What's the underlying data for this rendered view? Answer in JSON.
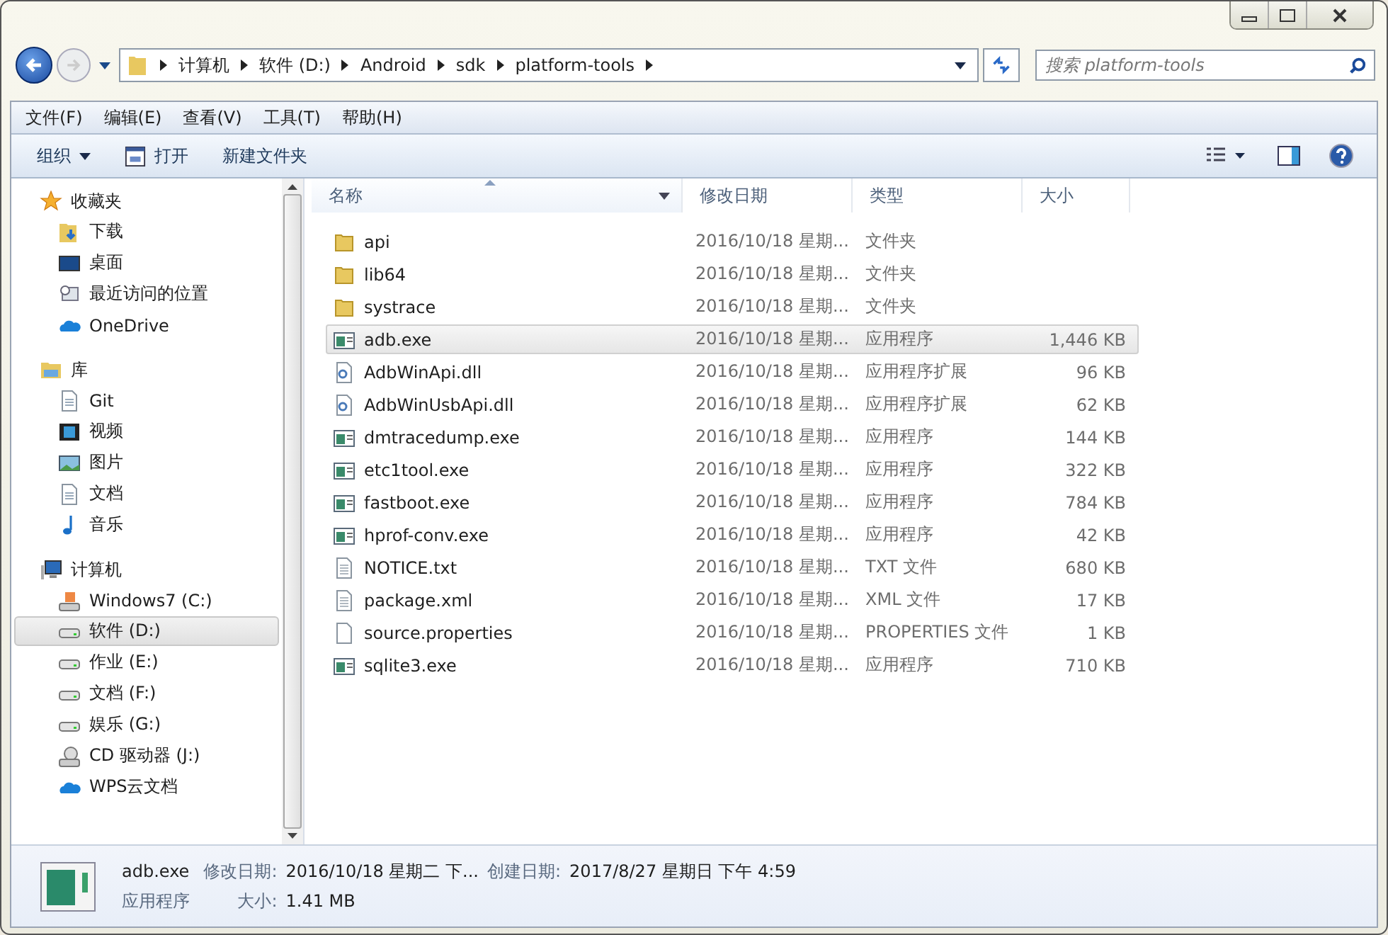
{
  "address": {
    "crumbs": [
      "计算机",
      "软件 (D:)",
      "Android",
      "sdk",
      "platform-tools"
    ]
  },
  "search": {
    "placeholder": "搜索 platform-tools"
  },
  "menu": [
    "文件(F)",
    "编辑(E)",
    "查看(V)",
    "工具(T)",
    "帮助(H)"
  ],
  "toolbar": [
    {
      "label": "组织",
      "kind": "dropdown"
    },
    {
      "label": "打开",
      "kind": "open"
    },
    {
      "label": "新建文件夹",
      "kind": "plain"
    }
  ],
  "sidebar": {
    "sections": [
      {
        "label": "收藏夹",
        "children": [
          {
            "label": "下载",
            "selected": false
          },
          {
            "label": "桌面",
            "selected": false
          },
          {
            "label": "最近访问的位置",
            "selected": false
          },
          {
            "label": "OneDrive",
            "selected": false
          }
        ]
      },
      {
        "label": "库",
        "children": [
          {
            "label": "Git",
            "selected": false
          },
          {
            "label": "视频",
            "selected": false
          },
          {
            "label": "图片",
            "selected": false
          },
          {
            "label": "文档",
            "selected": false
          },
          {
            "label": "音乐",
            "selected": false
          }
        ]
      },
      {
        "label": "计算机",
        "children": [
          {
            "label": "Windows7 (C:)",
            "selected": false
          },
          {
            "label": "软件 (D:)",
            "selected": true
          },
          {
            "label": "作业 (E:)",
            "selected": false
          },
          {
            "label": "文档 (F:)",
            "selected": false
          },
          {
            "label": "娱乐 (G:)",
            "selected": false
          },
          {
            "label": "CD 驱动器 (J:)",
            "selected": false
          },
          {
            "label": "WPS云文档",
            "selected": false
          }
        ]
      }
    ]
  },
  "table": {
    "columns": [
      {
        "label": "名称",
        "sorted": true
      },
      {
        "label": "修改日期",
        "sorted": false
      },
      {
        "label": "类型",
        "sorted": false
      },
      {
        "label": "大小",
        "sorted": false
      }
    ],
    "rows": [
      {
        "name": "api",
        "kind": "folder",
        "date": "2016/10/18 星期...",
        "type": "文件夹",
        "selected": false
      },
      {
        "name": "lib64",
        "kind": "folder",
        "date": "2016/10/18 星期...",
        "type": "文件夹",
        "selected": false
      },
      {
        "name": "systrace",
        "kind": "folder",
        "date": "2016/10/18 星期...",
        "type": "文件夹",
        "selected": false
      },
      {
        "name": "adb.exe",
        "kind": "exe",
        "date": "2016/10/18 星期...",
        "type": "应用程序",
        "size": "1,446 KB",
        "selected": true
      },
      {
        "name": "AdbWinApi.dll",
        "kind": "dll",
        "date": "2016/10/18 星期...",
        "type": "应用程序扩展",
        "size": "96 KB",
        "selected": false
      },
      {
        "name": "AdbWinUsbApi.dll",
        "kind": "dll",
        "date": "2016/10/18 星期...",
        "type": "应用程序扩展",
        "size": "62 KB",
        "selected": false
      },
      {
        "name": "dmtracedump.exe",
        "kind": "exe",
        "date": "2016/10/18 星期...",
        "type": "应用程序",
        "size": "144 KB",
        "selected": false
      },
      {
        "name": "etc1tool.exe",
        "kind": "exe",
        "date": "2016/10/18 星期...",
        "type": "应用程序",
        "size": "322 KB",
        "selected": false
      },
      {
        "name": "fastboot.exe",
        "kind": "exe",
        "date": "2016/10/18 星期...",
        "type": "应用程序",
        "size": "784 KB",
        "selected": false
      },
      {
        "name": "hprof-conv.exe",
        "kind": "exe",
        "date": "2016/10/18 星期...",
        "type": "应用程序",
        "size": "42 KB",
        "selected": false
      },
      {
        "name": "NOTICE.txt",
        "kind": "text",
        "date": "2016/10/18 星期...",
        "type": "TXT 文件",
        "size": "680 KB",
        "selected": false
      },
      {
        "name": "package.xml",
        "kind": "text",
        "date": "2016/10/18 星期...",
        "type": "XML 文件",
        "size": "17 KB",
        "selected": false
      },
      {
        "name": "source.properties",
        "kind": "blank",
        "date": "2016/10/18 星期...",
        "type": "PROPERTIES 文件",
        "size": "1 KB",
        "selected": false
      },
      {
        "name": "sqlite3.exe",
        "kind": "exe",
        "date": "2016/10/18 星期...",
        "type": "应用程序",
        "size": "710 KB",
        "selected": false
      }
    ]
  },
  "details": {
    "name": "adb.exe",
    "type": "应用程序",
    "modified_label": "修改日期:",
    "modified": "2016/10/18 星期二 下...",
    "created_label": "创建日期:",
    "created": "2017/8/27 星期日 下午 4:59",
    "size_label": "大小:",
    "size": "1.41 MB"
  }
}
